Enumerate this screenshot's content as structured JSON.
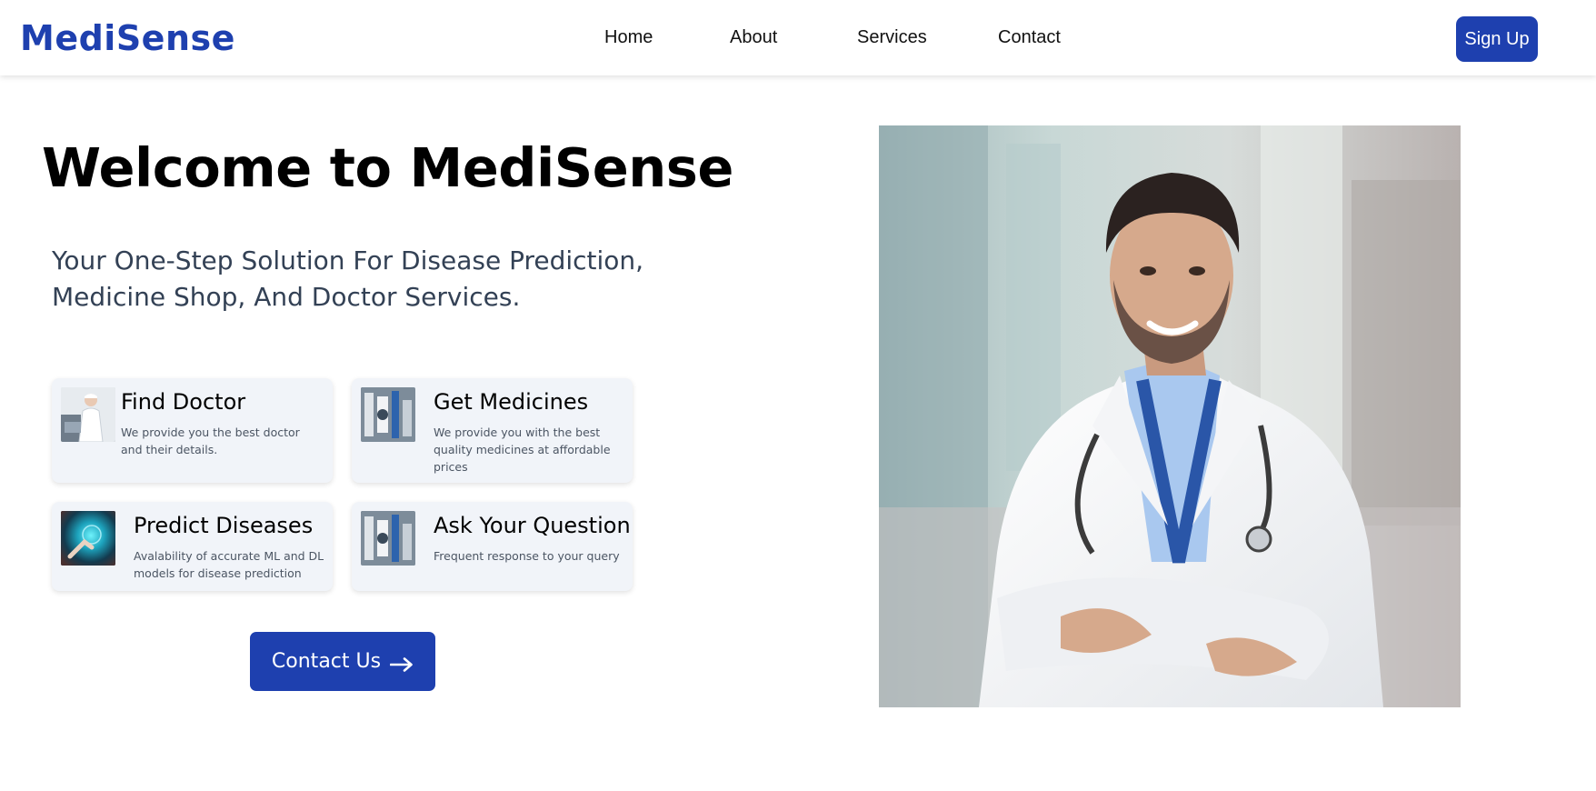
{
  "nav": {
    "logo": "MediSense",
    "links": [
      "Home",
      "About",
      "Services",
      "Contact"
    ],
    "signup_label": "Sign Up"
  },
  "hero": {
    "title": "Welcome to MediSense",
    "subtitle": "Your One-Step Solution For Disease Prediction, Medicine Shop, And Doctor Services."
  },
  "features": [
    {
      "title": "Find Doctor",
      "description": "We provide you the best doctor and their details.",
      "icon": "doctor-thumbnail"
    },
    {
      "title": "Get Medicines",
      "description": "We provide you with the best quality medicines at affordable prices",
      "icon": "medicines-thumbnail"
    },
    {
      "title": "Predict Diseases",
      "description": "Avalability of accurate ML and DL models for disease prediction",
      "icon": "ai-thumbnail"
    },
    {
      "title": "Ask Your Question",
      "description": "Frequent response to your query",
      "icon": "medicines-thumbnail"
    }
  ],
  "contact_button": {
    "label": "Contact Us"
  },
  "colors": {
    "brand": "#1e40af",
    "card_bg": "#f1f4f9",
    "subtitle": "#334155"
  }
}
